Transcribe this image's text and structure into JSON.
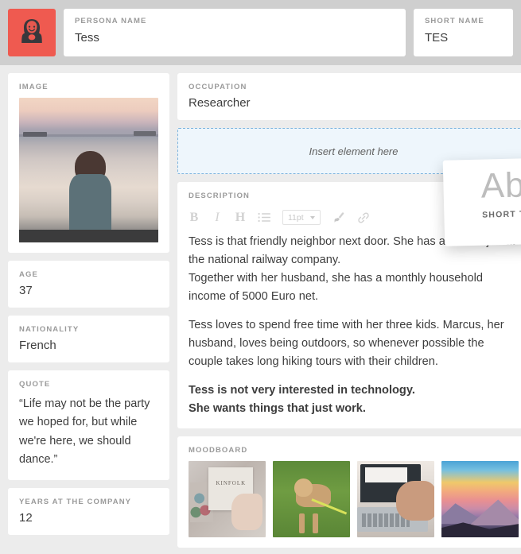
{
  "header": {
    "avatar_icon": "female-persona-avatar-icon",
    "avatar_color": "#ef5a50",
    "persona_name": {
      "label": "PERSONA NAME",
      "value": "Tess"
    },
    "short_name": {
      "label": "SHORT NAME",
      "value": "TES"
    }
  },
  "sidebar": {
    "image": {
      "label": "IMAGE",
      "alt": "Woman seen from behind looking at the sea at sunset"
    },
    "age": {
      "label": "AGE",
      "value": "37"
    },
    "nationality": {
      "label": "NATIONALITY",
      "value": "French"
    },
    "quote": {
      "label": "QUOTE",
      "value": "“Life may not be the party we hoped for, but while we're here, we should dance.”"
    },
    "years": {
      "label": "YEARS AT THE COMPANY",
      "value": "12"
    }
  },
  "main": {
    "occupation": {
      "label": "OCCUPATION",
      "value": "Researcher"
    },
    "dropzone": {
      "label": "Insert element here",
      "border_color": "#7db4de",
      "background": "#eef6fc"
    },
    "description": {
      "label": "DESCRIPTION",
      "toolbar": {
        "bold": "B",
        "italic": "I",
        "heading": "H",
        "bullet_list_icon": "bullet-list-icon",
        "font_size": "11pt",
        "brush_icon": "brush-icon",
        "link_icon": "link-icon"
      },
      "paragraphs": [
        {
          "text": "Tess is that friendly neighbor next door. She has a secure job at the national railway company.",
          "bold": false
        },
        {
          "text": "Together with her husband, she has a monthly household income of 5000 Euro net.",
          "bold": false
        },
        {
          "text": "Tess loves to spend free time with her three kids. Marcus, her husband, loves being outdoors, so whenever possible the couple takes long hiking tours with their children.",
          "bold": false
        },
        {
          "text": "Tess is not very interested in technology.",
          "bold": true
        },
        {
          "text": "She wants things that just work.",
          "bold": true
        }
      ]
    },
    "moodboard": {
      "label": "MOODBOARD",
      "items": [
        {
          "alt": "Person holding a KINFOLK magazine",
          "caption": "KINFOLK"
        },
        {
          "alt": "Beagle dog standing on grass with a leash"
        },
        {
          "alt": "Hands typing on a laptop keyboard"
        },
        {
          "alt": "Colorful sunset over mountain ridges"
        }
      ]
    }
  },
  "drag_card": {
    "glyph": "Ab",
    "label": "SHORT T"
  }
}
